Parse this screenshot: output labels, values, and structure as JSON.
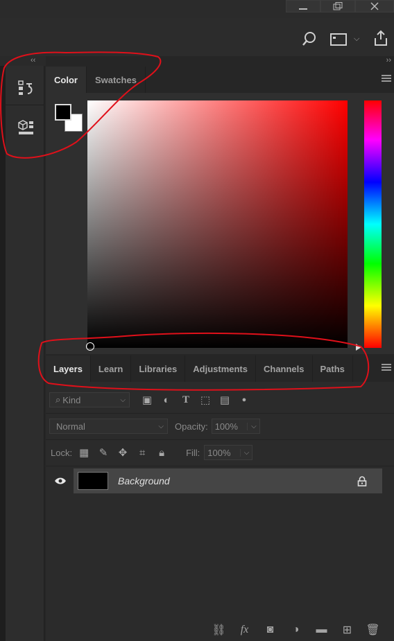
{
  "window": {
    "minimize_icon": "minimize-icon",
    "restore_icon": "restore-icon",
    "close_icon": "close-icon"
  },
  "optionbar": {
    "icons": [
      "search-icon",
      "workspace-layout-icon",
      "share-icon"
    ]
  },
  "strips": {
    "left": "‹‹",
    "right": "››"
  },
  "color_panel": {
    "tabs": [
      {
        "label": "Color"
      },
      {
        "label": "Swatches"
      }
    ],
    "foreground_color": "#000000",
    "background_color": "#ffffff",
    "picker_hue": "#ff0000"
  },
  "layers_panel": {
    "tabs": [
      {
        "label": "Layers"
      },
      {
        "label": "Learn"
      },
      {
        "label": "Libraries"
      },
      {
        "label": "Adjustments"
      },
      {
        "label": "Channels"
      },
      {
        "label": "Paths"
      }
    ],
    "filter": {
      "kind_label": "Kind"
    },
    "blend_mode": "Normal",
    "opacity_label": "Opacity:",
    "opacity_value": "100%",
    "lock_label": "Lock:",
    "fill_label": "Fill:",
    "fill_value": "100%",
    "layers": [
      {
        "name": "Background",
        "visible": true,
        "locked": true
      }
    ]
  },
  "annotation_color": "#e0101a"
}
